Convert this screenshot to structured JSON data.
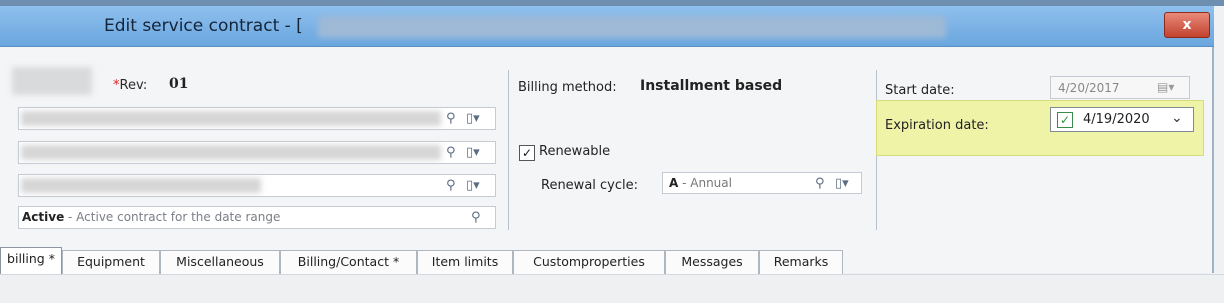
{
  "window": {
    "title": "Edit service contract - [",
    "close_label": "x"
  },
  "header": {
    "rev_label": "Rev:",
    "rev_required_mark": "*",
    "rev_value": "01"
  },
  "fields": {
    "status_code": "Active",
    "status_desc": " - Active contract for the date range"
  },
  "billing": {
    "method_label": "Billing method:",
    "method_value": "Installment based",
    "renewable_label": "Renewable",
    "renewable_checked": true,
    "renewal_cycle_label": "Renewal cycle:",
    "renewal_cycle_code": "A",
    "renewal_cycle_desc": " - Annual"
  },
  "dates": {
    "start_label": "Start date:",
    "start_value": "4/20/2017",
    "expiration_label": "Expiration date:",
    "expiration_value": "4/19/2020",
    "expiration_checked": true
  },
  "tabs": [
    {
      "label": "billing *"
    },
    {
      "label": "Equipment"
    },
    {
      "label": "Miscellaneous"
    },
    {
      "label": "Billing/Contact *"
    },
    {
      "label": "Item limits"
    },
    {
      "label": "Customproperties"
    },
    {
      "label": "Messages"
    },
    {
      "label": "Remarks"
    }
  ],
  "colors": {
    "titlebar": "#7fb3e6",
    "highlight": "#eef3a8",
    "close_button": "#c1412e"
  },
  "icons": {
    "search": "search-icon",
    "dropdown": "chevron-down-icon",
    "calendar": "calendar-icon",
    "document": "document-menu-icon"
  }
}
